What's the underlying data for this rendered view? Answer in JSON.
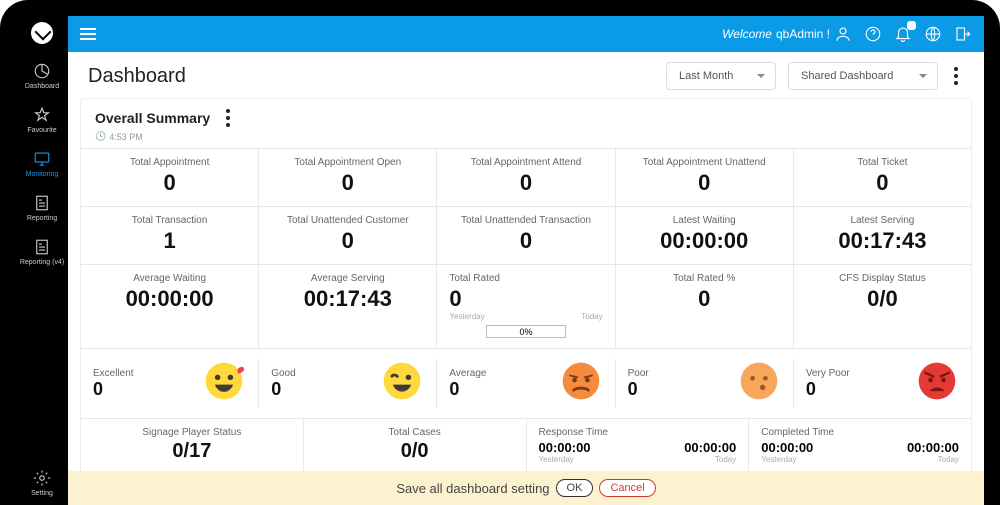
{
  "topbar": {
    "welcome_prefix": "Welcome",
    "username": "qbAdmin !",
    "notif_badge": ""
  },
  "sidebar": {
    "items": [
      {
        "label": "Dashboard"
      },
      {
        "label": "Favourite"
      },
      {
        "label": "Monitoring"
      },
      {
        "label": "Reporting"
      },
      {
        "label": "Reporting (v4)"
      }
    ],
    "bottom": {
      "label": "Setting"
    }
  },
  "page": {
    "title": "Dashboard",
    "range": "Last Month",
    "dashboard": "Shared Dashboard"
  },
  "summary": {
    "title": "Overall Summary",
    "time": "4:53 PM",
    "row1": [
      {
        "label": "Total Appointment",
        "value": "0"
      },
      {
        "label": "Total Appointment Open",
        "value": "0"
      },
      {
        "label": "Total Appointment Attend",
        "value": "0"
      },
      {
        "label": "Total Appointment Unattend",
        "value": "0"
      },
      {
        "label": "Total Ticket",
        "value": "0"
      }
    ],
    "row2": [
      {
        "label": "Total Transaction",
        "value": "1"
      },
      {
        "label": "Total Unattended Customer",
        "value": "0"
      },
      {
        "label": "Total Unattended Transaction",
        "value": "0"
      },
      {
        "label": "Latest Waiting",
        "value": "00:00:00"
      },
      {
        "label": "Latest Serving",
        "value": "00:17:43"
      }
    ],
    "row3": [
      {
        "label": "Average Waiting",
        "value": "00:00:00"
      },
      {
        "label": "Average Serving",
        "value": "00:17:43"
      },
      {
        "label": "Total Rated",
        "value": "0",
        "yesterday": "Yesterday",
        "today": "Today",
        "progress": "0%"
      },
      {
        "label": "Total Rated %",
        "value": "0"
      },
      {
        "label": "CFS Display Status",
        "value": "0/0"
      }
    ],
    "ratings": [
      {
        "label": "Excellent",
        "value": "0"
      },
      {
        "label": "Good",
        "value": "0"
      },
      {
        "label": "Average",
        "value": "0"
      },
      {
        "label": "Poor",
        "value": "0"
      },
      {
        "label": "Very Poor",
        "value": "0"
      }
    ],
    "row5": [
      {
        "label": "Signage Player Status",
        "value": "0/17"
      },
      {
        "label": "Total Cases",
        "value": "0/0"
      },
      {
        "label": "Response Time",
        "v1": "00:00:00",
        "v2": "00:00:00",
        "l1": "Yesterday",
        "l2": "Today"
      },
      {
        "label": "Completed Time",
        "v1": "00:00:00",
        "v2": "00:00:00",
        "l1": "Yesterday",
        "l2": "Today"
      }
    ]
  },
  "savebar": {
    "message": "Save all dashboard setting",
    "ok": "OK",
    "cancel": "Cancel"
  }
}
